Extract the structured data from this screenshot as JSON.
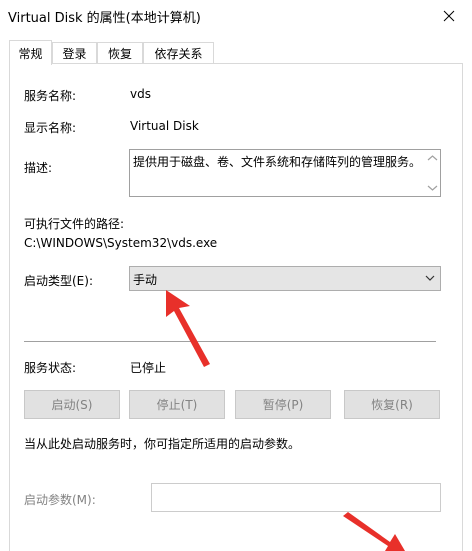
{
  "window": {
    "title": "Virtual Disk 的属性(本地计算机)"
  },
  "tabs": [
    {
      "label": "常规",
      "active": true
    },
    {
      "label": "登录",
      "active": false
    },
    {
      "label": "恢复",
      "active": false
    },
    {
      "label": "依存关系",
      "active": false
    }
  ],
  "general": {
    "service_name_label": "服务名称:",
    "service_name_value": "vds",
    "display_name_label": "显示名称:",
    "display_name_value": "Virtual Disk",
    "description_label": "描述:",
    "description_value": "提供用于磁盘、卷、文件系统和存储阵列的管理服务。",
    "path_label": "可执行文件的路径:",
    "path_value": "C:\\WINDOWS\\System32\\vds.exe",
    "startup_type_label": "启动类型(E):",
    "startup_type_value": "手动",
    "service_status_label": "服务状态:",
    "service_status_value": "已停止",
    "buttons": {
      "start": "启动(S)",
      "stop": "停止(T)",
      "pause": "暂停(P)",
      "resume": "恢复(R)"
    },
    "hint_text": "当从此处启动服务时，你可指定所适用的启动参数。",
    "start_params_label": "启动参数(M):",
    "start_params_value": ""
  },
  "colors": {
    "annotation_arrow": "#e8302a",
    "disabled_text": "#838383",
    "disabled_button_bg": "#e1e1e1",
    "select_bg": "#e5e5e5"
  }
}
